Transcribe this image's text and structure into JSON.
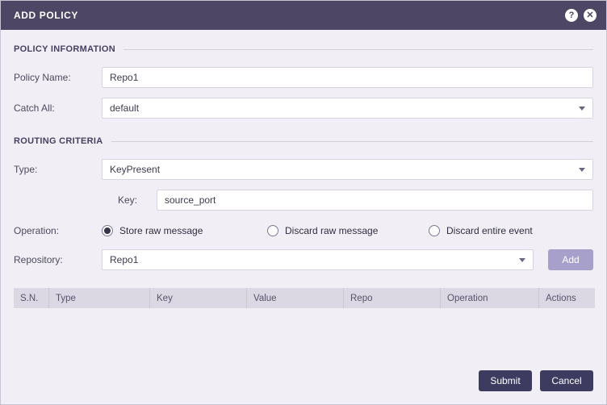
{
  "dialog": {
    "title": "ADD POLICY",
    "help_icon": "?",
    "close_icon": "✕"
  },
  "sections": {
    "policy_information": "POLICY INFORMATION",
    "routing_criteria": "ROUTING CRITERIA"
  },
  "fields": {
    "policy_name": {
      "label": "Policy Name:",
      "value": "Repo1"
    },
    "catch_all": {
      "label": "Catch All:",
      "value": "default"
    },
    "type": {
      "label": "Type:",
      "value": "KeyPresent"
    },
    "key": {
      "label": "Key:",
      "value": "source_port"
    },
    "operation": {
      "label": "Operation:",
      "options": [
        {
          "label": "Store raw message",
          "selected": true
        },
        {
          "label": "Discard raw message",
          "selected": false
        },
        {
          "label": "Discard entire event",
          "selected": false
        }
      ]
    },
    "repository": {
      "label": "Repository:",
      "value": "Repo1",
      "add_label": "Add"
    }
  },
  "table": {
    "headers": [
      "S.N.",
      "Type",
      "Key",
      "Value",
      "Repo",
      "Operation",
      "Actions"
    ],
    "rows": []
  },
  "footer": {
    "submit_label": "Submit",
    "cancel_label": "Cancel"
  },
  "colors": {
    "header_bg": "#4d4664",
    "body_bg": "#f1eff5",
    "button_bg": "#3e3b61",
    "add_button_bg": "#a7a0ca",
    "table_header_bg": "#dbd8e3",
    "section_heading_text": "#474060"
  }
}
